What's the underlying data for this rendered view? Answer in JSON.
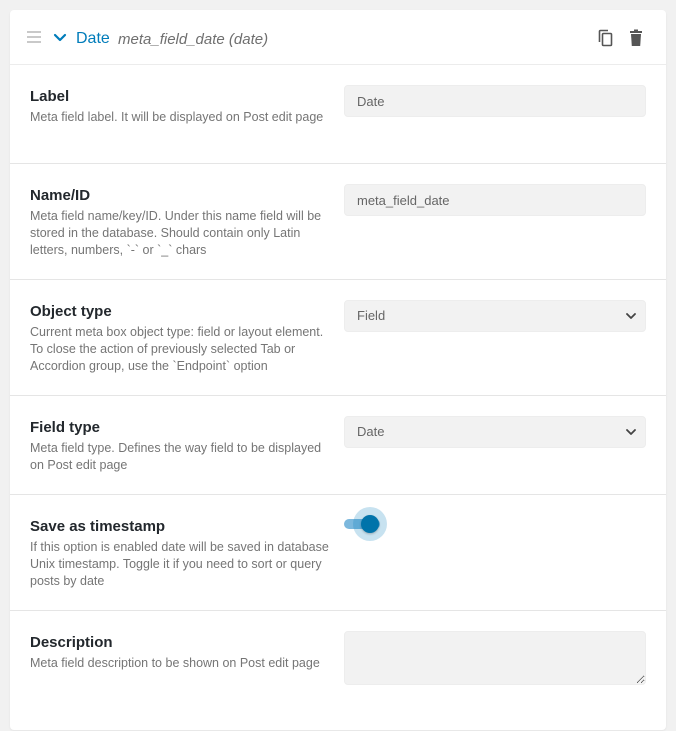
{
  "colors": {
    "accent": "#007cba",
    "toggle_on": "#0073aa",
    "muted_text": "#757575"
  },
  "header": {
    "title": "Date",
    "meta": "meta_field_date (date)",
    "icons": {
      "drag": "drag-handle-icon",
      "collapse": "chevron-down-icon",
      "copy": "copy-icon",
      "delete": "trash-icon"
    }
  },
  "fields": {
    "label": {
      "title": "Label",
      "description": "Meta field label. It will be displayed on Post edit page",
      "value": "Date"
    },
    "name_id": {
      "title": "Name/ID",
      "description": "Meta field name/key/ID. Under this name field will be stored in the database. Should contain only Latin letters, numbers, `-` or `_` chars",
      "value": "meta_field_date"
    },
    "object_type": {
      "title": "Object type",
      "description": "Current meta box object type: field or layout element. To close the action of previously selected Tab or Accordion group, use the `Endpoint` option",
      "selected": "Field"
    },
    "field_type": {
      "title": "Field type",
      "description": "Meta field type. Defines the way field to be displayed on Post edit page",
      "selected": "Date"
    },
    "save_as_timestamp": {
      "title": "Save as timestamp",
      "description": "If this option is enabled date will be saved in database Unix timestamp. Toggle it if you need to sort or query posts by date",
      "enabled": true
    },
    "description": {
      "title": "Description",
      "description": "Meta field description to be shown on Post edit page",
      "value": ""
    }
  }
}
